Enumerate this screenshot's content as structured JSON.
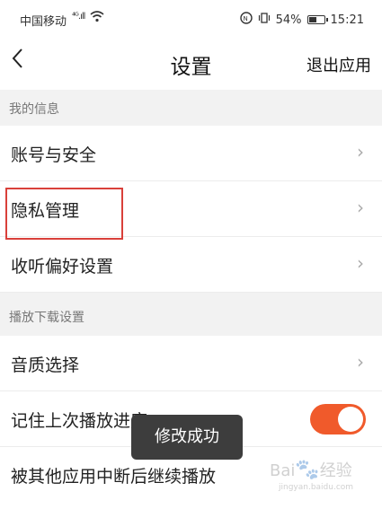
{
  "status_bar": {
    "carrier": "中国移动",
    "signal_glyph": "⁴ᴳ.ıll",
    "wifi_icon": "wifi-icon",
    "battery_percent": "54%",
    "battery_level": 0.54,
    "time": "15:21"
  },
  "nav": {
    "back_icon": "‹",
    "title": "设置",
    "exit_label": "退出应用"
  },
  "sections": [
    {
      "header": "我的信息"
    },
    {
      "header": "播放下载设置"
    }
  ],
  "rows": {
    "account_security": "账号与安全",
    "privacy": "隐私管理",
    "listening_pref": "收听偏好设置",
    "audio_quality": "音质选择",
    "remember_progress": "记住上次播放进度",
    "continue_after_interrupt": "被其他应用中断后继续播放"
  },
  "chevron": "›",
  "toggle": {
    "remember_progress_on": true,
    "color": "#f05a2b"
  },
  "toast": {
    "text": "修改成功"
  },
  "highlight_color": "#d9403a",
  "watermark": {
    "brand": "Bai",
    "brand2": "经验",
    "url": "jingyan.baidu.com"
  }
}
